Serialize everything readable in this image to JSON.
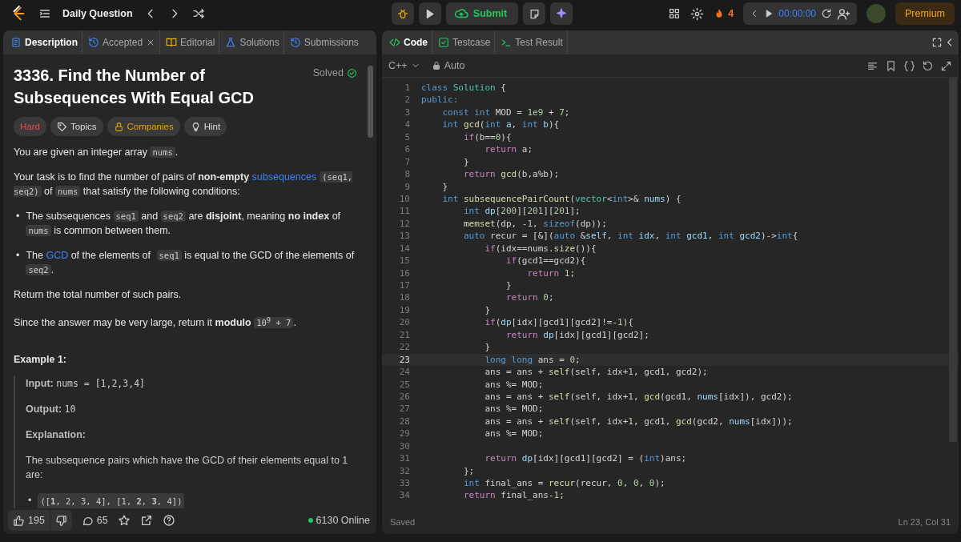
{
  "topbar": {
    "title": "Daily Question",
    "submit": "Submit",
    "streak": "4",
    "timer": "00:00:00",
    "premium": "Premium"
  },
  "left_panel": {
    "tabs": [
      {
        "label": "Description",
        "kind": "description",
        "selected": true
      },
      {
        "label": "Accepted",
        "kind": "accepted",
        "selected": false
      },
      {
        "label": "Editorial",
        "kind": "editorial",
        "selected": false
      },
      {
        "label": "Solutions",
        "kind": "solutions",
        "selected": false
      },
      {
        "label": "Submissions",
        "kind": "submissions",
        "selected": false
      }
    ],
    "title": "3336. Find the Number of Subsequences With Equal GCD",
    "status": "Solved",
    "tags": [
      {
        "label": "Hard",
        "kind": "difficulty"
      },
      {
        "label": "Topics",
        "kind": "topics"
      },
      {
        "label": "Companies",
        "kind": "companies"
      },
      {
        "label": "Hint",
        "kind": "hint"
      }
    ],
    "paragraphs": [
      [
        {
          "kind": "text",
          "text": "You are given an integer array "
        },
        {
          "kind": "code",
          "text": "nums"
        },
        {
          "kind": "text",
          "text": "."
        }
      ],
      [
        {
          "kind": "text",
          "text": "Your task is to find the number of pairs of **non-empty** "
        },
        {
          "kind": "link",
          "text": "subsequences"
        },
        {
          "kind": "code",
          "text": "(seq1, seq2)"
        },
        {
          "kind": "text",
          "text": " of "
        },
        {
          "kind": "code",
          "text": "nums"
        },
        {
          "kind": "text",
          "text": " that satisfy the following conditions:"
        }
      ]
    ],
    "bullets": [
      {
        "marker": "•",
        "segments": [
          {
            "kind": "text",
            "text": "The subsequences "
          },
          {
            "kind": "code",
            "text": "seq1"
          },
          {
            "kind": "text",
            "text": " and "
          },
          {
            "kind": "code",
            "text": "seq2"
          },
          {
            "kind": "text",
            "text": " are **disjoint**, meaning **no index** of "
          },
          {
            "kind": "code",
            "text": "nums"
          },
          {
            "kind": "text",
            "text": " is common between them."
          }
        ]
      },
      {
        "marker": "•",
        "segments": [
          {
            "kind": "text",
            "text": "The "
          },
          {
            "kind": "link",
            "text": "GCD"
          },
          {
            "kind": "text",
            "text": " of the elements of "
          },
          {
            "kind": "code",
            "text": "seq1"
          },
          {
            "kind": "text",
            "text": " is equal to the GCD of the elements of "
          },
          {
            "kind": "code",
            "text": "seq2"
          },
          {
            "kind": "text",
            "text": "."
          }
        ]
      }
    ],
    "paragraphs_after": [
      [
        {
          "kind": "text",
          "text": "Return the total number of such pairs."
        }
      ],
      [
        {
          "kind": "text",
          "text": "Since the answer may be very large, return it **modulo** "
        },
        {
          "kind": "code",
          "text": "10$^{9}$ + 7"
        },
        {
          "kind": "text",
          "text": "."
        }
      ]
    ],
    "example": {
      "heading": "Example 1:",
      "input_label": "Input:",
      "input": "nums = [1,2,3,4]",
      "output_label": "Output:",
      "output": "10",
      "explanation_label": "Explanation:",
      "explanation": "The subsequence pairs which have the GCD of their elements equal to 1 are:",
      "pairs": [
        {
          "marker": "•",
          "text": "([**1**, 2, 3, 4], [1, **2**, **3**, 4])"
        }
      ]
    },
    "footer": {
      "likes": "195",
      "comments": "65",
      "online": "6130 Online"
    }
  },
  "right_panel": {
    "tabs": [
      {
        "label": "Code",
        "kind": "code",
        "selected": true
      },
      {
        "label": "Testcase",
        "kind": "testcase",
        "selected": false
      },
      {
        "label": "Test Result",
        "kind": "result",
        "selected": false
      }
    ],
    "language": "C++",
    "mode": "Auto",
    "lines": [
      {
        "n": "1",
        "current": false,
        "tokens": [
          {
            "kind": "kw",
            "text": "class "
          },
          {
            "kind": "ty",
            "text": "Solution"
          },
          {
            "kind": "p",
            "text": " {"
          }
        ]
      },
      {
        "n": "2",
        "current": false,
        "tokens": [
          {
            "kind": "kw",
            "text": "public:"
          }
        ]
      },
      {
        "n": "3",
        "current": false,
        "tokens": [
          {
            "kind": "kw",
            "text": "    const int "
          },
          {
            "kind": "p",
            "text": "MOD = "
          },
          {
            "kind": "nm",
            "text": "1e9"
          },
          {
            "kind": "p",
            "text": " + "
          },
          {
            "kind": "nm",
            "text": "7"
          },
          {
            "kind": "p",
            "text": ";"
          }
        ]
      },
      {
        "n": "4",
        "current": false,
        "tokens": [
          {
            "kind": "kw",
            "text": "    int "
          },
          {
            "kind": "fn",
            "text": "gcd"
          },
          {
            "kind": "p",
            "text": "("
          },
          {
            "kind": "kw",
            "text": "int "
          },
          {
            "kind": "vr",
            "text": "a"
          },
          {
            "kind": "p",
            "text": ", "
          },
          {
            "kind": "kw",
            "text": "int "
          },
          {
            "kind": "vr",
            "text": "b"
          },
          {
            "kind": "p",
            "text": "){"
          }
        ]
      },
      {
        "n": "5",
        "current": false,
        "tokens": [
          {
            "kind": "ct",
            "text": "        if"
          },
          {
            "kind": "p",
            "text": "(b=="
          },
          {
            "kind": "nm",
            "text": "0"
          },
          {
            "kind": "p",
            "text": "){"
          }
        ]
      },
      {
        "n": "6",
        "current": false,
        "tokens": [
          {
            "kind": "ct",
            "text": "            return "
          },
          {
            "kind": "p",
            "text": "a;"
          }
        ]
      },
      {
        "n": "7",
        "current": false,
        "tokens": [
          {
            "kind": "p",
            "text": "        }"
          }
        ]
      },
      {
        "n": "8",
        "current": false,
        "tokens": [
          {
            "kind": "ct",
            "text": "        return "
          },
          {
            "kind": "fn",
            "text": "gcd"
          },
          {
            "kind": "p",
            "text": "(b,a%b);"
          }
        ]
      },
      {
        "n": "9",
        "current": false,
        "tokens": [
          {
            "kind": "p",
            "text": "    }"
          }
        ]
      },
      {
        "n": "10",
        "current": false,
        "tokens": [
          {
            "kind": "kw",
            "text": "    int "
          },
          {
            "kind": "fn",
            "text": "subsequencePairCount"
          },
          {
            "kind": "p",
            "text": "("
          },
          {
            "kind": "ty",
            "text": "vector"
          },
          {
            "kind": "p",
            "text": "<"
          },
          {
            "kind": "kw",
            "text": "int"
          },
          {
            "kind": "p",
            "text": ">& "
          },
          {
            "kind": "vr",
            "text": "nums"
          },
          {
            "kind": "p",
            "text": ") {"
          }
        ]
      },
      {
        "n": "11",
        "current": false,
        "tokens": [
          {
            "kind": "kw",
            "text": "        int "
          },
          {
            "kind": "vr",
            "text": "dp"
          },
          {
            "kind": "p",
            "text": "["
          },
          {
            "kind": "nm",
            "text": "200"
          },
          {
            "kind": "p",
            "text": "]["
          },
          {
            "kind": "nm",
            "text": "201"
          },
          {
            "kind": "p",
            "text": "]["
          },
          {
            "kind": "nm",
            "text": "201"
          },
          {
            "kind": "p",
            "text": "];"
          }
        ]
      },
      {
        "n": "12",
        "current": false,
        "tokens": [
          {
            "kind": "fn",
            "text": "        memset"
          },
          {
            "kind": "p",
            "text": "(dp, -"
          },
          {
            "kind": "nm",
            "text": "1"
          },
          {
            "kind": "p",
            "text": ", "
          },
          {
            "kind": "kw",
            "text": "sizeof"
          },
          {
            "kind": "p",
            "text": "(dp));"
          }
        ]
      },
      {
        "n": "13",
        "current": false,
        "tokens": [
          {
            "kind": "kw",
            "text": "        auto "
          },
          {
            "kind": "p",
            "text": "recur = [&]("
          },
          {
            "kind": "kw",
            "text": "auto "
          },
          {
            "kind": "p",
            "text": "&"
          },
          {
            "kind": "vr",
            "text": "self"
          },
          {
            "kind": "p",
            "text": ", "
          },
          {
            "kind": "kw",
            "text": "int "
          },
          {
            "kind": "vr",
            "text": "idx"
          },
          {
            "kind": "p",
            "text": ", "
          },
          {
            "kind": "kw",
            "text": "int "
          },
          {
            "kind": "vr",
            "text": "gcd1"
          },
          {
            "kind": "p",
            "text": ", "
          },
          {
            "kind": "kw",
            "text": "int "
          },
          {
            "kind": "vr",
            "text": "gcd2"
          },
          {
            "kind": "p",
            "text": ")->"
          },
          {
            "kind": "kw",
            "text": "int"
          },
          {
            "kind": "p",
            "text": "{"
          }
        ]
      },
      {
        "n": "14",
        "current": false,
        "tokens": [
          {
            "kind": "ct",
            "text": "            if"
          },
          {
            "kind": "p",
            "text": "(idx==nums."
          },
          {
            "kind": "fn",
            "text": "size"
          },
          {
            "kind": "p",
            "text": "()){"
          }
        ]
      },
      {
        "n": "15",
        "current": false,
        "tokens": [
          {
            "kind": "ct",
            "text": "                if"
          },
          {
            "kind": "p",
            "text": "(gcd1==gcd2){"
          }
        ]
      },
      {
        "n": "16",
        "current": false,
        "tokens": [
          {
            "kind": "ct",
            "text": "                    return "
          },
          {
            "kind": "nm",
            "text": "1"
          },
          {
            "kind": "p",
            "text": ";"
          }
        ]
      },
      {
        "n": "17",
        "current": false,
        "tokens": [
          {
            "kind": "p",
            "text": "                }"
          }
        ]
      },
      {
        "n": "18",
        "current": false,
        "tokens": [
          {
            "kind": "ct",
            "text": "                return "
          },
          {
            "kind": "nm",
            "text": "0"
          },
          {
            "kind": "p",
            "text": ";"
          }
        ]
      },
      {
        "n": "19",
        "current": false,
        "tokens": [
          {
            "kind": "p",
            "text": "            }"
          }
        ]
      },
      {
        "n": "20",
        "current": false,
        "tokens": [
          {
            "kind": "ct",
            "text": "            if"
          },
          {
            "kind": "p",
            "text": "("
          },
          {
            "kind": "vr",
            "text": "dp"
          },
          {
            "kind": "p",
            "text": "[idx][gcd1][gcd2]!=-"
          },
          {
            "kind": "nm",
            "text": "1"
          },
          {
            "kind": "p",
            "text": "){"
          }
        ]
      },
      {
        "n": "21",
        "current": false,
        "tokens": [
          {
            "kind": "ct",
            "text": "                return "
          },
          {
            "kind": "vr",
            "text": "dp"
          },
          {
            "kind": "p",
            "text": "[idx][gcd1][gcd2];"
          }
        ]
      },
      {
        "n": "22",
        "current": false,
        "tokens": [
          {
            "kind": "p",
            "text": "            }"
          }
        ]
      },
      {
        "n": "23",
        "current": true,
        "tokens": [
          {
            "kind": "kw",
            "text": "            long long "
          },
          {
            "kind": "p",
            "text": "ans = "
          },
          {
            "kind": "nm",
            "text": "0"
          },
          {
            "kind": "p",
            "text": ";"
          }
        ]
      },
      {
        "n": "24",
        "current": false,
        "tokens": [
          {
            "kind": "p",
            "text": "            ans = ans + "
          },
          {
            "kind": "fn",
            "text": "self"
          },
          {
            "kind": "p",
            "text": "(self, idx+"
          },
          {
            "kind": "nm",
            "text": "1"
          },
          {
            "kind": "p",
            "text": ", gcd1, gcd2);"
          }
        ]
      },
      {
        "n": "25",
        "current": false,
        "tokens": [
          {
            "kind": "p",
            "text": "            ans %= MOD;"
          }
        ]
      },
      {
        "n": "26",
        "current": false,
        "tokens": [
          {
            "kind": "p",
            "text": "            ans = ans + "
          },
          {
            "kind": "fn",
            "text": "self"
          },
          {
            "kind": "p",
            "text": "(self, idx+"
          },
          {
            "kind": "nm",
            "text": "1"
          },
          {
            "kind": "p",
            "text": ", "
          },
          {
            "kind": "fn",
            "text": "gcd"
          },
          {
            "kind": "p",
            "text": "(gcd1, "
          },
          {
            "kind": "vr",
            "text": "nums"
          },
          {
            "kind": "p",
            "text": "[idx]), gcd2);"
          }
        ]
      },
      {
        "n": "27",
        "current": false,
        "tokens": [
          {
            "kind": "p",
            "text": "            ans %= MOD;"
          }
        ]
      },
      {
        "n": "28",
        "current": false,
        "tokens": [
          {
            "kind": "p",
            "text": "            ans = ans + "
          },
          {
            "kind": "fn",
            "text": "self"
          },
          {
            "kind": "p",
            "text": "(self, idx+"
          },
          {
            "kind": "nm",
            "text": "1"
          },
          {
            "kind": "p",
            "text": ", gcd1, "
          },
          {
            "kind": "fn",
            "text": "gcd"
          },
          {
            "kind": "p",
            "text": "(gcd2, "
          },
          {
            "kind": "vr",
            "text": "nums"
          },
          {
            "kind": "p",
            "text": "[idx]));"
          }
        ]
      },
      {
        "n": "29",
        "current": false,
        "tokens": [
          {
            "kind": "p",
            "text": "            ans %= MOD;"
          }
        ]
      },
      {
        "n": "30",
        "current": false
      },
      {
        "n": "31",
        "current": false,
        "tokens": [
          {
            "kind": "ct",
            "text": "            return "
          },
          {
            "kind": "vr",
            "text": "dp"
          },
          {
            "kind": "p",
            "text": "[idx][gcd1][gcd2] = ("
          },
          {
            "kind": "kw",
            "text": "int"
          },
          {
            "kind": "p",
            "text": ")ans;"
          }
        ]
      },
      {
        "n": "32",
        "current": false,
        "tokens": [
          {
            "kind": "p",
            "text": "        };"
          }
        ]
      },
      {
        "n": "33",
        "current": false,
        "tokens": [
          {
            "kind": "kw",
            "text": "        int "
          },
          {
            "kind": "p",
            "text": "final_ans = "
          },
          {
            "kind": "fn",
            "text": "recur"
          },
          {
            "kind": "p",
            "text": "(recur, "
          },
          {
            "kind": "nm",
            "text": "0"
          },
          {
            "kind": "p",
            "text": ", "
          },
          {
            "kind": "nm",
            "text": "0"
          },
          {
            "kind": "p",
            "text": ", "
          },
          {
            "kind": "nm",
            "text": "0"
          },
          {
            "kind": "p",
            "text": ");"
          }
        ]
      },
      {
        "n": "34",
        "current": false,
        "tokens": [
          {
            "kind": "ct",
            "text": "        return "
          },
          {
            "kind": "p",
            "text": "final_ans-"
          },
          {
            "kind": "nm",
            "text": "1"
          },
          {
            "kind": "p",
            "text": ";"
          }
        ]
      }
    ],
    "status": "Saved",
    "cursor": "Ln 23, Col 31"
  }
}
